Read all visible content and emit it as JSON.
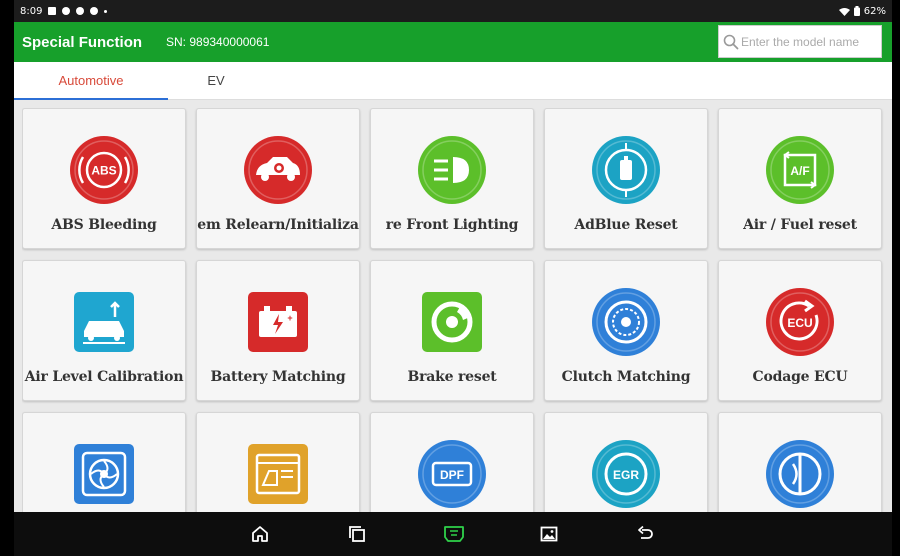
{
  "status_bar": {
    "time": "8:09",
    "battery": "62%",
    "left_icons": [
      "image-notification-icon",
      "settings-notification-icon",
      "sync-notification-icon",
      "chat-notification-icon"
    ],
    "right_icons": [
      "wifi-icon",
      "battery-icon"
    ]
  },
  "header": {
    "title": "Special Function",
    "sn_label": "SN: 989340000061",
    "background": "#17a02b",
    "search_placeholder": "Enter the model name"
  },
  "tabs": [
    {
      "label": "Automotive",
      "active": true,
      "color": "#d84a3a"
    },
    {
      "label": "EV",
      "active": false
    }
  ],
  "functions": [
    {
      "label": "ABS Bleeding",
      "icon": "abs-icon",
      "color": "#d62a2a",
      "shape": "circle",
      "glyph": "ABS"
    },
    {
      "label": "em Relearn/Initializa",
      "icon": "car-engine-icon",
      "color": "#d62a2a",
      "shape": "circle"
    },
    {
      "label": "re Front Lighting",
      "icon": "headlight-icon",
      "color": "#5cbf2a",
      "shape": "circle"
    },
    {
      "label": "AdBlue Reset",
      "icon": "adblue-icon",
      "color": "#1ca3c4",
      "shape": "circle"
    },
    {
      "label": "Air / Fuel reset",
      "icon": "air-fuel-icon",
      "color": "#5cbf2a",
      "shape": "circle",
      "glyph": "A/F"
    },
    {
      "label": "Air Level Calibration",
      "icon": "car-lift-icon",
      "color": "#1fa6d0",
      "shape": "square"
    },
    {
      "label": "Battery Matching",
      "icon": "battery-icon",
      "color": "#d62a2a",
      "shape": "square"
    },
    {
      "label": "Brake reset",
      "icon": "brake-disc-icon",
      "color": "#5cbf2a",
      "shape": "square"
    },
    {
      "label": "Clutch Matching",
      "icon": "clutch-icon",
      "color": "#2f80d8",
      "shape": "circle"
    },
    {
      "label": "Codage ECU",
      "icon": "ecu-icon",
      "color": "#d62a2a",
      "shape": "circle",
      "glyph": "ECU"
    },
    {
      "label": "",
      "icon": "fan-icon",
      "color": "#2f80d8",
      "shape": "square"
    },
    {
      "label": "",
      "icon": "window-icon",
      "color": "#e0a22a",
      "shape": "square"
    },
    {
      "label": "",
      "icon": "dpf-icon",
      "color": "#2f80d8",
      "shape": "circle",
      "glyph": "DPF"
    },
    {
      "label": "",
      "icon": "egr-icon",
      "color": "#1ca3c4",
      "shape": "circle",
      "glyph": "EGR"
    },
    {
      "label": "",
      "icon": "throttle-icon",
      "color": "#2f80d8",
      "shape": "circle"
    }
  ],
  "nav_bar": [
    {
      "icon": "home-icon"
    },
    {
      "icon": "recent-apps-icon"
    },
    {
      "icon": "vci-icon"
    },
    {
      "icon": "screenshot-icon"
    },
    {
      "icon": "back-icon"
    }
  ]
}
